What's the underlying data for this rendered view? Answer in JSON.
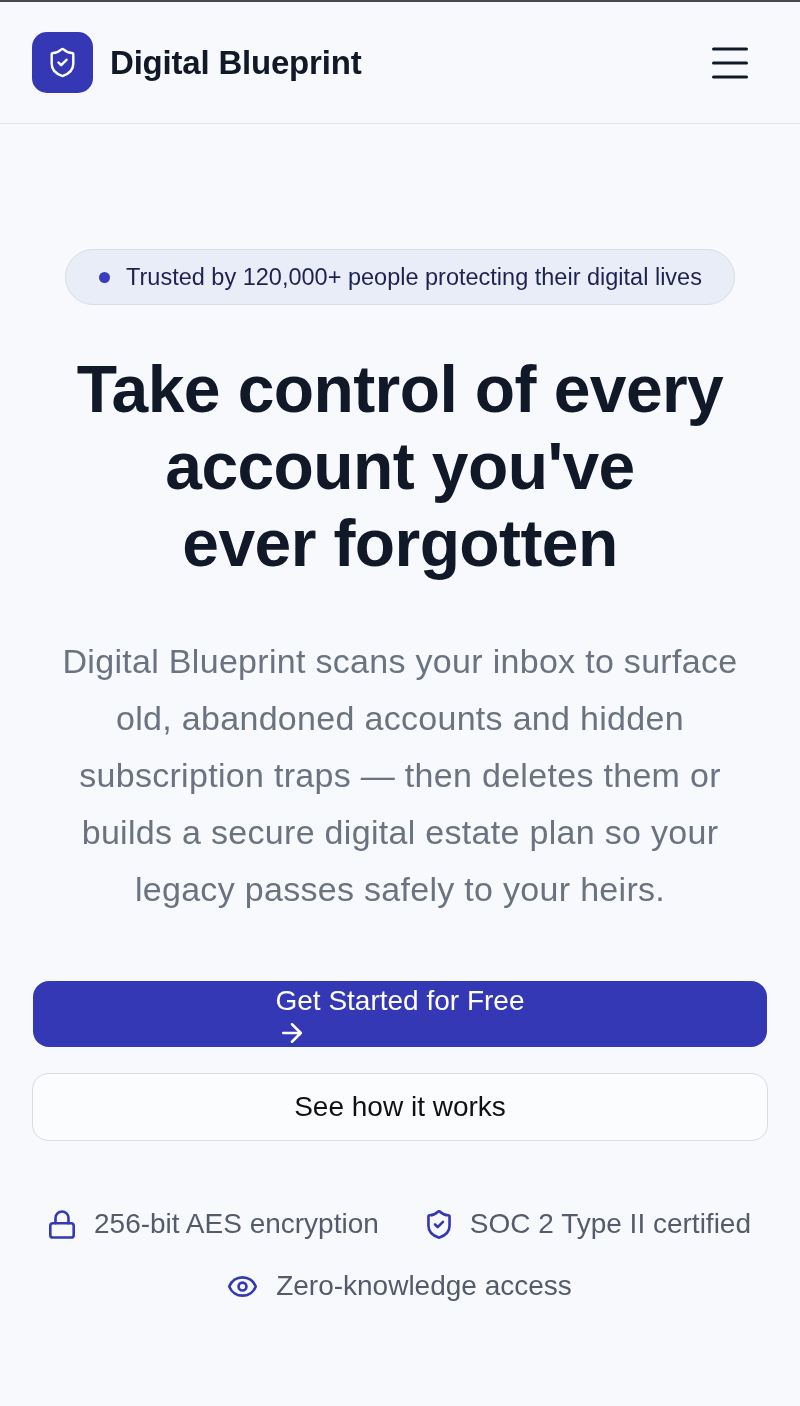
{
  "header": {
    "brand": "Digital Blueprint"
  },
  "hero": {
    "badge": "Trusted by 120,000+ people protecting their digital lives",
    "title_lines": [
      "Take control of every",
      "account you've",
      "ever forgotten"
    ],
    "description_lines": [
      "Digital Blueprint scans your inbox to surface",
      "old, abandoned accounts and hidden",
      "subscription traps — then deletes them or",
      "builds a secure digital estate plan so your",
      "legacy passes safely to your heirs."
    ]
  },
  "buttons": [
    {
      "kind": "primary",
      "label": "Get Started for Free"
    },
    {
      "kind": "secondary",
      "label": "See how it works"
    }
  ],
  "trust_items": [
    "256-bit AES encryption",
    "SOC 2 Type II certified",
    "Zero-knowledge access"
  ]
}
